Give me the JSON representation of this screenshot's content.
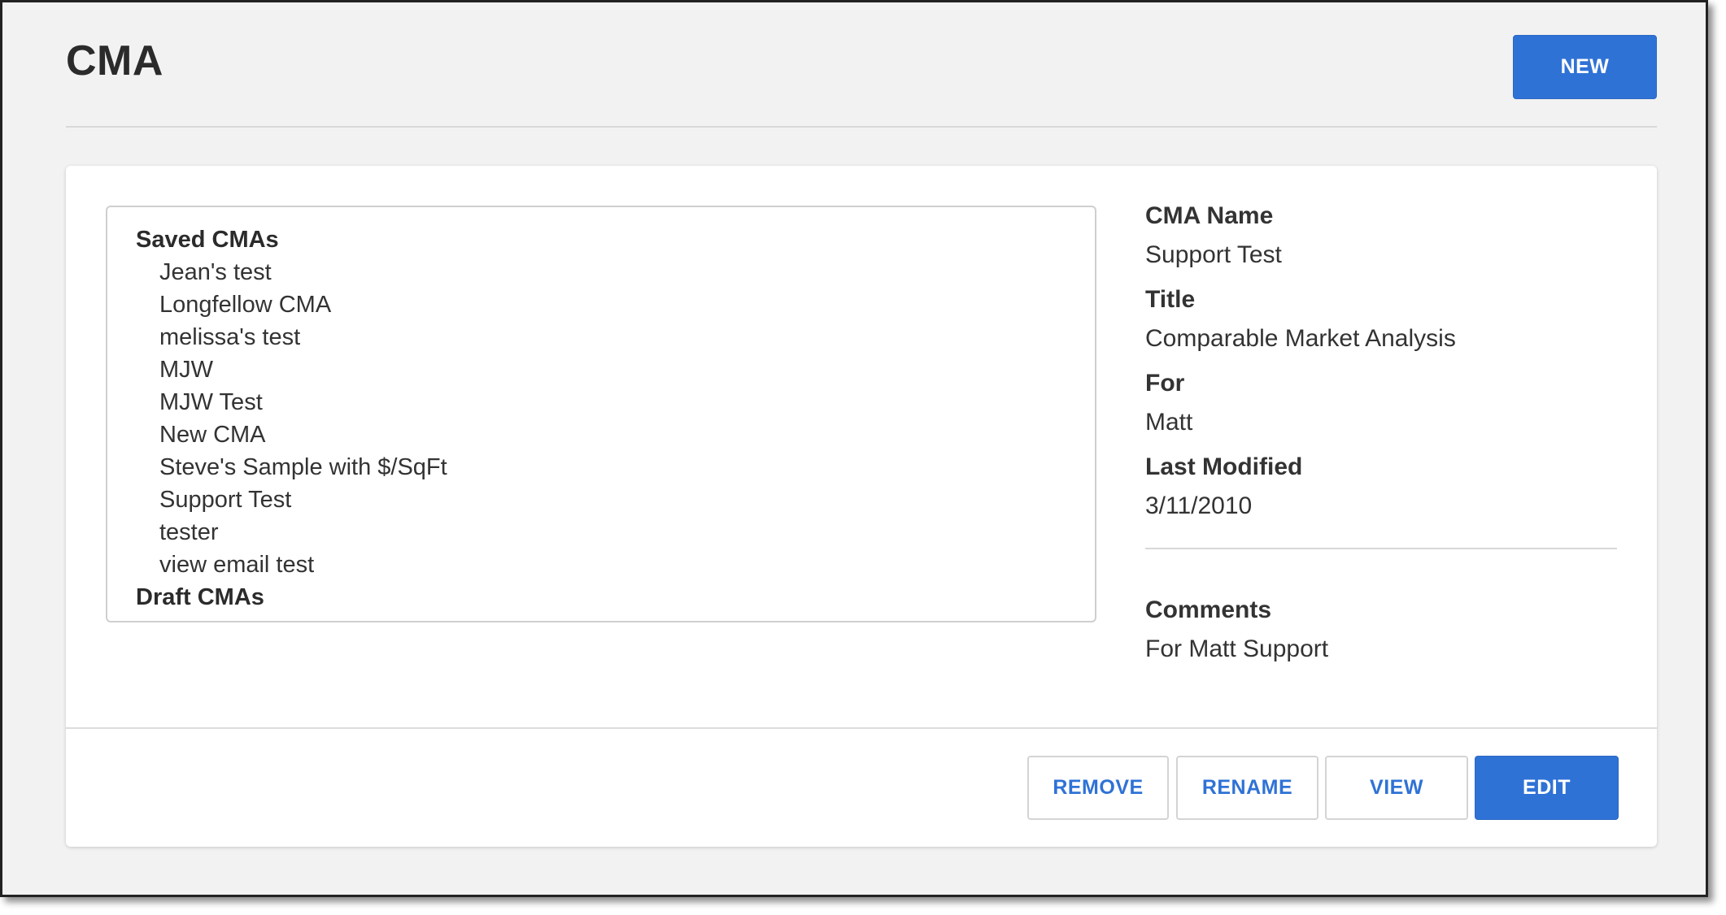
{
  "header": {
    "title": "CMA",
    "new_label": "NEW"
  },
  "cma_list": {
    "groups": [
      {
        "label": "Saved CMAs",
        "items": [
          "Jean's test",
          "Longfellow CMA",
          "melissa's test",
          "MJW",
          "MJW Test",
          "New CMA",
          "Steve's Sample with $/SqFt",
          "Support Test",
          "tester",
          "view email test"
        ]
      },
      {
        "label": "Draft CMAs",
        "items": []
      }
    ]
  },
  "details": {
    "name_label": "CMA Name",
    "name_value": "Support Test",
    "title_label": "Title",
    "title_value": "Comparable Market Analysis",
    "for_label": "For",
    "for_value": "Matt",
    "modified_label": "Last Modified",
    "modified_value": "3/11/2010",
    "comments_label": "Comments",
    "comments_value": "For Matt Support"
  },
  "actions": {
    "remove_label": "REMOVE",
    "rename_label": "RENAME",
    "view_label": "VIEW",
    "edit_label": "EDIT"
  },
  "colors": {
    "accent": "#2f72d6",
    "background": "#f2f2f2",
    "card": "#ffffff"
  }
}
